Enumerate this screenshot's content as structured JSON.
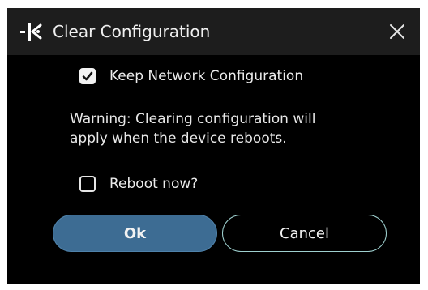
{
  "dialog": {
    "title": "Clear Configuration",
    "logo_icon": "company-logo-icon",
    "close_icon": "close-icon"
  },
  "options": {
    "keep_network": {
      "label": "Keep Network Configuration",
      "checked": true
    },
    "reboot_now": {
      "label": "Reboot now?",
      "checked": false
    }
  },
  "warning": {
    "line1": "Warning: Clearing configuration will",
    "line2": "apply when the device reboots."
  },
  "buttons": {
    "ok_label": "Ok",
    "cancel_label": "Cancel"
  },
  "colors": {
    "dialog_bg": "#000000",
    "titlebar_bg": "#1d1d1d",
    "ok_button": "#3d6c93",
    "cancel_border": "#9ed0cf"
  }
}
